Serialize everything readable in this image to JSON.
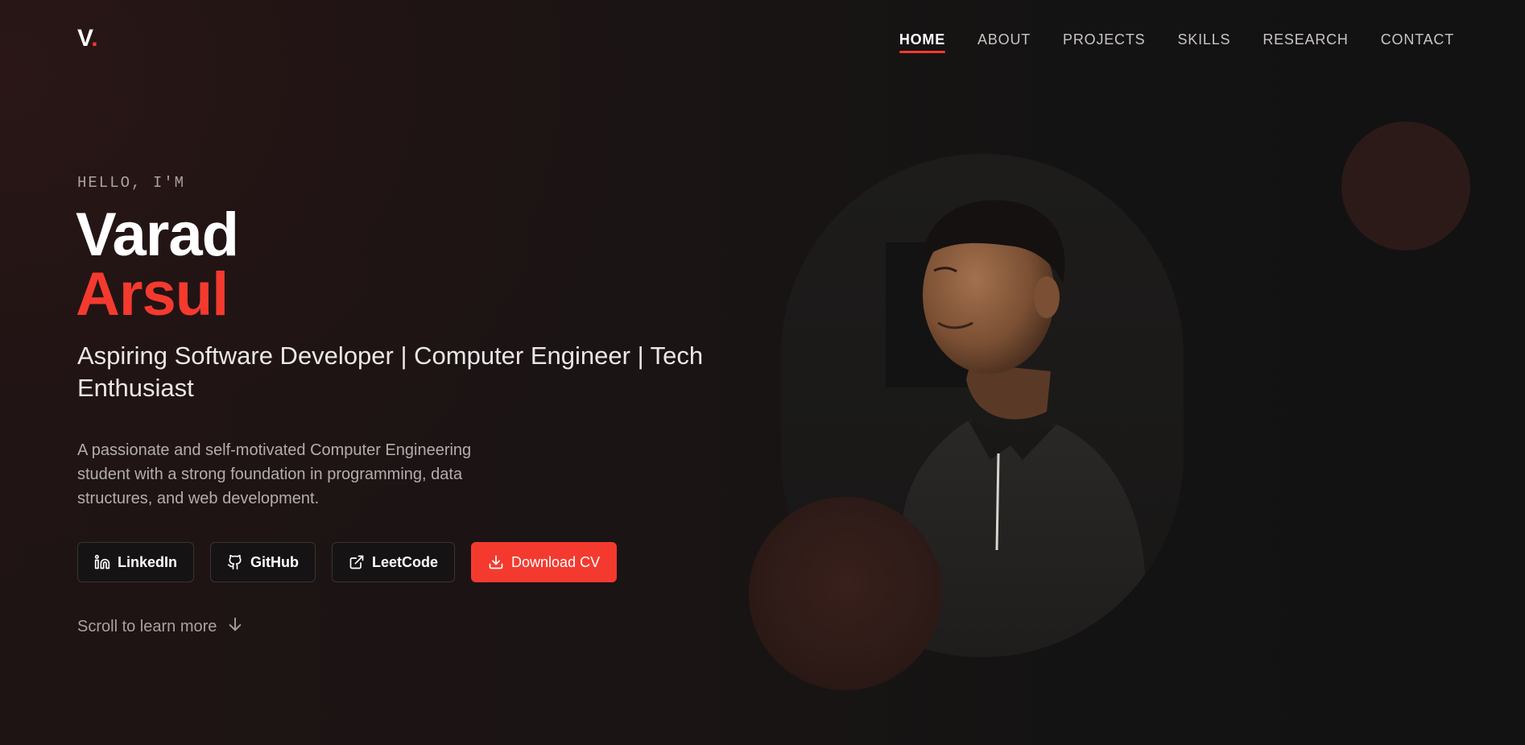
{
  "brand": {
    "logo_text": "V",
    "logo_dot": "."
  },
  "nav": {
    "items": [
      {
        "label": "HOME",
        "active": true
      },
      {
        "label": "ABOUT",
        "active": false
      },
      {
        "label": "PROJECTS",
        "active": false
      },
      {
        "label": "SKILLS",
        "active": false
      },
      {
        "label": "RESEARCH",
        "active": false
      },
      {
        "label": "CONTACT",
        "active": false
      }
    ]
  },
  "hero": {
    "greeting": "HELLO, I'M",
    "first_name": "Varad",
    "last_name": "Arsul",
    "subtitle": "Aspiring Software Developer | Computer Engineer | Tech Enthusiast",
    "description": "A passionate and self-motivated Computer Engineering student with a strong foundation in programming, data structures, and web development.",
    "scroll_text": "Scroll to learn more"
  },
  "buttons": {
    "linkedin": {
      "label": "LinkedIn",
      "icon": "linkedin-icon"
    },
    "github": {
      "label": "GitHub",
      "icon": "github-icon"
    },
    "leetcode": {
      "label": "LeetCode",
      "icon": "external-link-icon"
    },
    "download_cv": {
      "label": "Download CV",
      "icon": "download-icon"
    }
  },
  "colors": {
    "accent": "#f43a2f",
    "background": "#141313",
    "text": "#ffffff",
    "muted_text": "#b3adad"
  }
}
